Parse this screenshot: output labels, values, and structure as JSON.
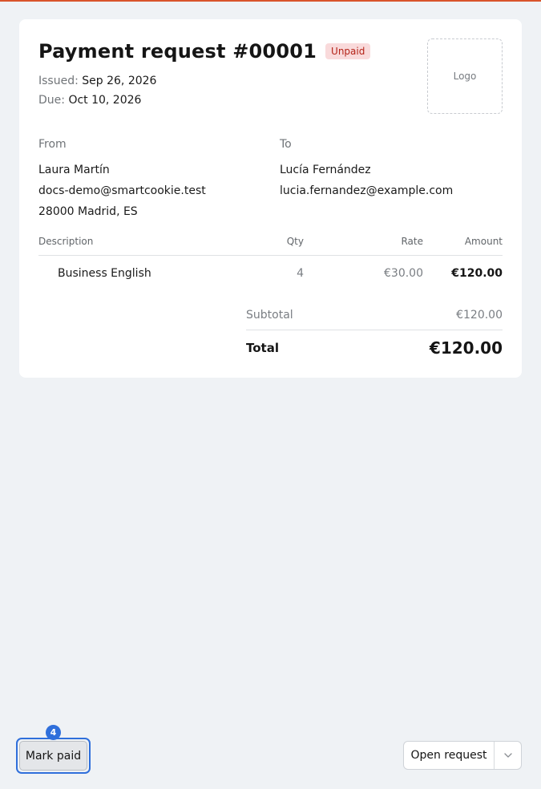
{
  "invoice": {
    "title": "Payment request #00001",
    "status": "Unpaid",
    "issued_label": "Issued:",
    "issued_date": "Sep 26, 2026",
    "due_label": "Due:",
    "due_date": "Oct 10, 2026",
    "logo_placeholder": "Logo",
    "from": {
      "label": "From",
      "name": "Laura Martín",
      "email": "docs-demo@smartcookie.test",
      "address": "28000 Madrid, ES"
    },
    "to": {
      "label": "To",
      "name": "Lucía Fernández",
      "email": "lucia.fernandez@example.com"
    },
    "table": {
      "headers": [
        "Description",
        "Qty",
        "Rate",
        "Amount"
      ],
      "rows": [
        {
          "description": "Business English",
          "qty": "4",
          "rate": "€30.00",
          "amount": "€120.00"
        }
      ]
    },
    "subtotal_label": "Subtotal",
    "subtotal_value": "€120.00",
    "total_label": "Total",
    "total_value": "€120.00"
  },
  "footer": {
    "mark_paid_label": "Mark paid",
    "step_number": "4",
    "open_request_label": "Open request",
    "open_request_menu_icon": "chevron-down-icon"
  },
  "colors": {
    "background": "#eff2f5",
    "accent": "#2f6fdb",
    "unpaid_badge_bg": "#f9dadb",
    "unpaid_badge_text": "#b42318"
  }
}
